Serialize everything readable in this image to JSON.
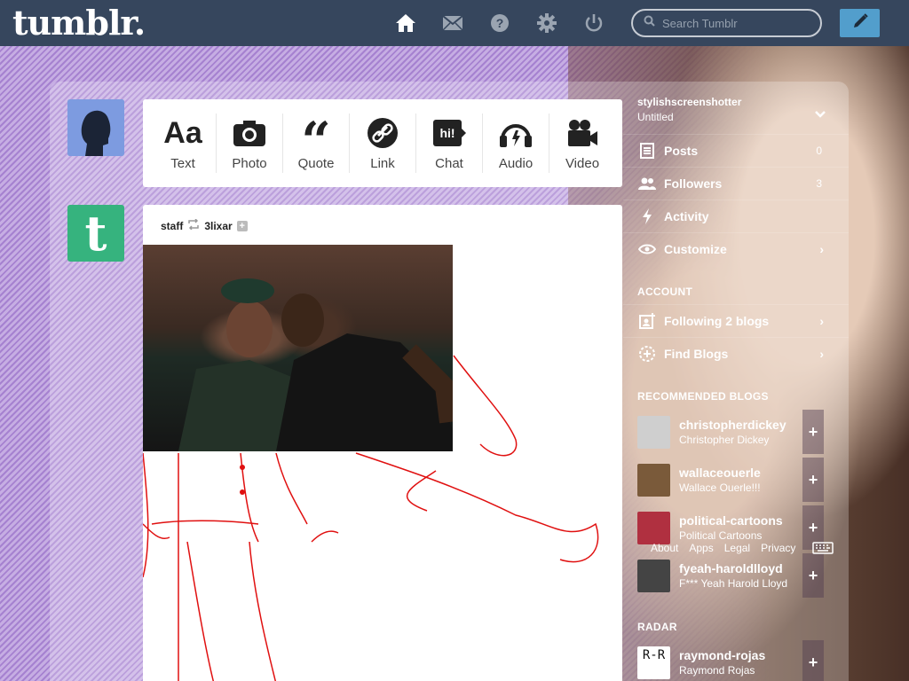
{
  "header": {
    "logo": "tumblr.",
    "search_placeholder": "Search Tumblr",
    "nav_icons": [
      "home-icon",
      "mail-icon",
      "help-icon",
      "gear-icon",
      "power-icon"
    ],
    "compose_icon": "pencil-icon"
  },
  "post_types": [
    {
      "label": "Text",
      "icon": "text-icon"
    },
    {
      "label": "Photo",
      "icon": "camera-icon"
    },
    {
      "label": "Quote",
      "icon": "quote-icon"
    },
    {
      "label": "Link",
      "icon": "link-icon"
    },
    {
      "label": "Chat",
      "icon": "chat-icon"
    },
    {
      "label": "Audio",
      "icon": "headphones-icon"
    },
    {
      "label": "Video",
      "icon": "video-camera-icon"
    }
  ],
  "post": {
    "author": "staff",
    "reblogged_from": "3lixar",
    "avatar_letter": "t"
  },
  "sidebar": {
    "username": "stylishscreenshotter",
    "blog_title": "Untitled",
    "rows": [
      {
        "label": "Posts",
        "count": "0",
        "icon": "posts-icon"
      },
      {
        "label": "Followers",
        "count": "3",
        "icon": "followers-icon"
      },
      {
        "label": "Activity",
        "icon": "activity-icon"
      },
      {
        "label": "Customize",
        "icon": "eye-icon"
      }
    ],
    "account_heading": "ACCOUNT",
    "account_rows": [
      {
        "label": "Following 2 blogs",
        "icon": "following-icon"
      },
      {
        "label": "Find Blogs",
        "icon": "find-blogs-icon"
      }
    ],
    "recommended_heading": "RECOMMENDED BLOGS",
    "recommended": [
      {
        "name": "christopherdickey",
        "subtitle": "Christopher Dickey",
        "color": "#cfcfcf"
      },
      {
        "name": "wallaceouerle",
        "subtitle": "Wallace Ouerle!!!",
        "color": "#7a5a3a"
      },
      {
        "name": "political-cartoons",
        "subtitle": "Political Cartoons",
        "color": "#b03040"
      },
      {
        "name": "fyeah-haroldlloyd",
        "subtitle": "F*** Yeah Harold Lloyd",
        "color": "#444444"
      }
    ],
    "radar_heading": "RADAR",
    "radar": {
      "name": "raymond-rojas",
      "subtitle": "Raymond Rojas",
      "thumb_text": "R-R"
    }
  },
  "footer": {
    "links": [
      "About",
      "Apps",
      "Legal",
      "Privacy"
    ]
  },
  "colors": {
    "header_bg": "#36465d",
    "compose": "#529ecc",
    "accent_green": "#36b37e"
  }
}
